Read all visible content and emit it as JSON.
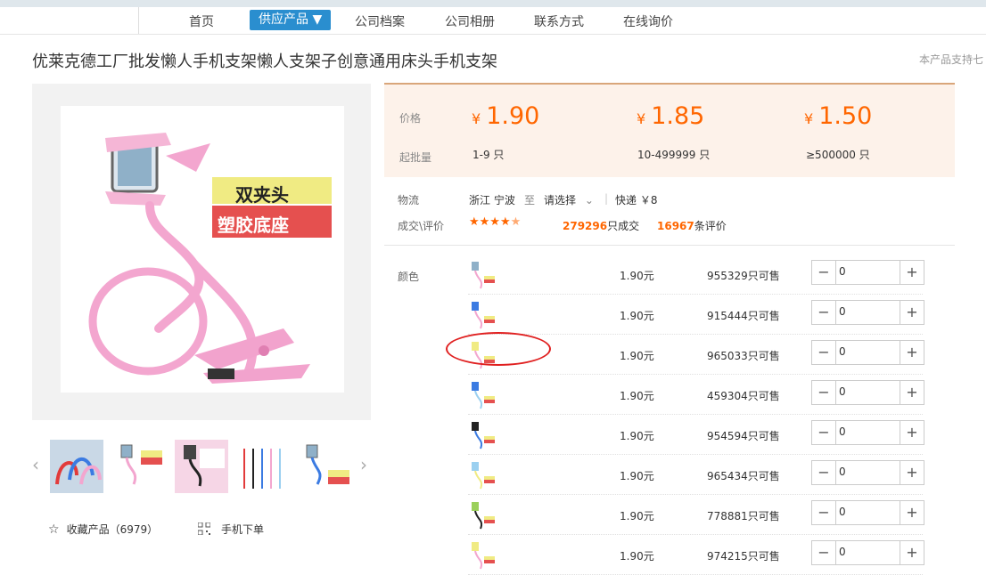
{
  "nav": {
    "items": [
      "首页",
      "供应产品 ▼",
      "公司档案",
      "公司相册",
      "联系方式",
      "在线询价"
    ]
  },
  "product": {
    "title": "优莱克德工厂批发懒人手机支架懒人支架子创意通用床头手机支架",
    "support_text": "本产品支持七",
    "image_text_1": "双夹头",
    "image_text_2": "塑胶底座",
    "favorite_label": "收藏产品（6979）",
    "mobile_order_label": "手机下单"
  },
  "pricing": {
    "price_label": "价格",
    "moq_label": "起批量",
    "currency": "¥",
    "tiers": [
      {
        "price": "1.90",
        "range": "1-9 只"
      },
      {
        "price": "1.85",
        "range": "10-499999 只"
      },
      {
        "price": "1.50",
        "range": "≥500000 只"
      }
    ]
  },
  "logistics": {
    "label": "物流",
    "from": "浙江 宁波",
    "to_label": "至",
    "select_placeholder": "请选择",
    "express": "快递 ￥8"
  },
  "deals": {
    "label": "成交\\评价",
    "rating": 4.5,
    "deals_count": "279296",
    "deals_suffix": "只成交",
    "reviews_count": "16967",
    "reviews_suffix": "条评价"
  },
  "variants": {
    "label": "颜色",
    "rows": [
      {
        "price": "1.90元",
        "stock": "955329只可售",
        "qty": "0"
      },
      {
        "price": "1.90元",
        "stock": "915444只可售",
        "qty": "0"
      },
      {
        "price": "1.90元",
        "stock": "965033只可售",
        "qty": "0"
      },
      {
        "price": "1.90元",
        "stock": "459304只可售",
        "qty": "0"
      },
      {
        "price": "1.90元",
        "stock": "954594只可售",
        "qty": "0"
      },
      {
        "price": "1.90元",
        "stock": "965434只可售",
        "qty": "0"
      },
      {
        "price": "1.90元",
        "stock": "778881只可售",
        "qty": "0"
      },
      {
        "price": "1.90元",
        "stock": "974215只可售",
        "qty": "0"
      }
    ]
  },
  "colors": {
    "accent": "#ff6600",
    "nav_active": "#2a8ecf",
    "product_pink": "#f3a6cf",
    "highlight": "#e02020"
  }
}
